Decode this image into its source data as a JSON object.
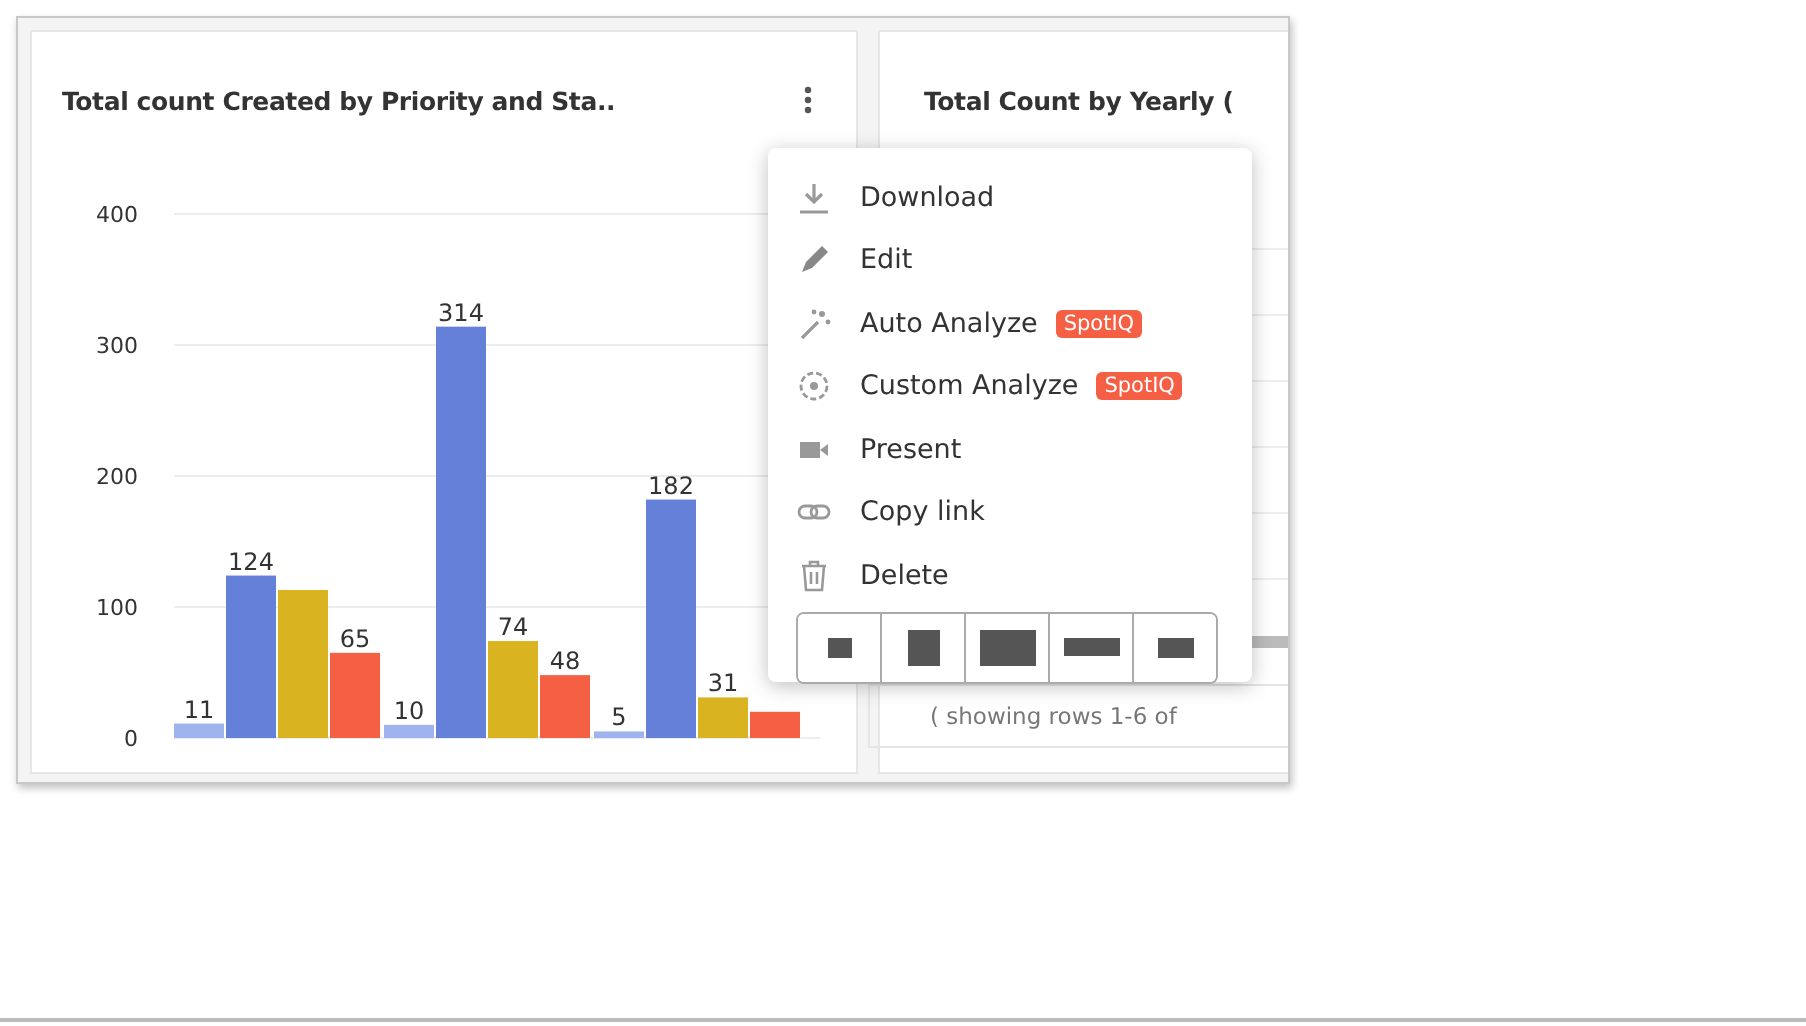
{
  "cards": [
    {
      "title": "Total count Created by Priority and Sta..",
      "chart_data": {
        "type": "bar",
        "grid": true,
        "yticks": [
          0,
          100,
          200,
          300,
          400
        ],
        "ylim": [
          0,
          400
        ],
        "data_labels": true,
        "series": [
          {
            "color": "#9fb3ef",
            "values": [
              11,
              10,
              5
            ],
            "value_labels": [
              "11",
              "10",
              "5"
            ]
          },
          {
            "color": "#6480d8",
            "values": [
              124,
              314,
              182
            ],
            "value_labels": [
              "124",
              "314",
              "182"
            ]
          },
          {
            "color": "#dab320",
            "values": [
              113,
              74,
              31
            ],
            "value_labels": [
              null,
              "74",
              "31"
            ]
          },
          {
            "color": "#f55f44",
            "values": [
              65,
              48,
              20
            ],
            "value_labels": [
              "65",
              "48",
              null
            ]
          }
        ]
      }
    },
    {
      "title": "Total Count by Yearly (",
      "footer": "( showing rows 1-6 of"
    }
  ],
  "menu": {
    "items": [
      {
        "label": "Download",
        "kind": "download"
      },
      {
        "label": "Edit",
        "kind": "edit"
      },
      {
        "label": "Auto Analyze",
        "kind": "auto",
        "badge": "SpotIQ"
      },
      {
        "label": "Custom Analyze",
        "kind": "custom",
        "badge": "SpotIQ"
      },
      {
        "label": "Present",
        "kind": "present"
      },
      {
        "label": "Copy link",
        "kind": "link"
      },
      {
        "label": "Delete",
        "kind": "delete"
      }
    ],
    "sizes": [
      {
        "kind": "xs",
        "selected": false
      },
      {
        "kind": "s",
        "selected": false
      },
      {
        "kind": "l",
        "selected": false
      },
      {
        "kind": "wide",
        "selected": false
      },
      {
        "kind": "wide-s",
        "selected": false
      }
    ]
  }
}
